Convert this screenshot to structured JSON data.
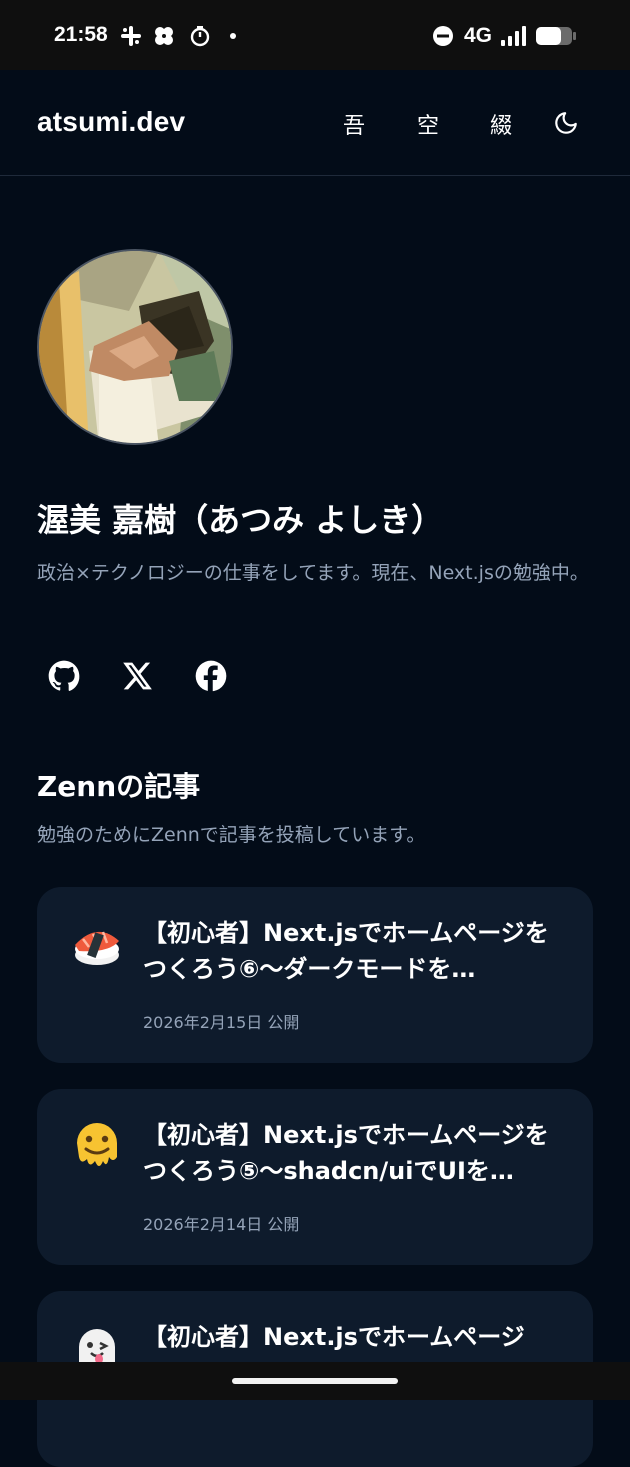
{
  "status_bar": {
    "time": "21:58",
    "network": "4G",
    "icons": [
      "slack-icon",
      "pinwheel-icon",
      "timer-icon",
      "dot-icon",
      "dnd-icon",
      "signal-icon",
      "battery-icon"
    ]
  },
  "header": {
    "brand": "atsumi.dev",
    "nav": [
      "吾",
      "空",
      "綴"
    ],
    "theme_icon": "moon-icon"
  },
  "profile": {
    "name": "渥美 嘉樹（あつみ よしき）",
    "bio": "政治×テクノロジーの仕事をしてます。現在、Next.jsの勉強中。",
    "social": [
      "github-icon",
      "x-icon",
      "facebook-icon"
    ]
  },
  "zenn": {
    "title": "Zennの記事",
    "description": "勉強のためにZennで記事を投稿しています。",
    "articles": [
      {
        "emoji": "sushi-emoji",
        "title": "【初心者】Next.jsでホームページをつくろう⑥〜ダークモードを…",
        "date": "2026年2月15日 公開"
      },
      {
        "emoji": "melting-face-emoji",
        "title": "【初心者】Next.jsでホームページをつくろう⑤〜shadcn/uiでUIを…",
        "date": "2026年2月14日 公開"
      },
      {
        "emoji": "ghost-emoji",
        "title": "【初心者】Next.jsでホームページ",
        "date": ""
      }
    ]
  },
  "colors": {
    "background": "#030c18",
    "card": "#0e1b2c",
    "muted_text": "#94a3b8",
    "text": "#ffffff"
  }
}
